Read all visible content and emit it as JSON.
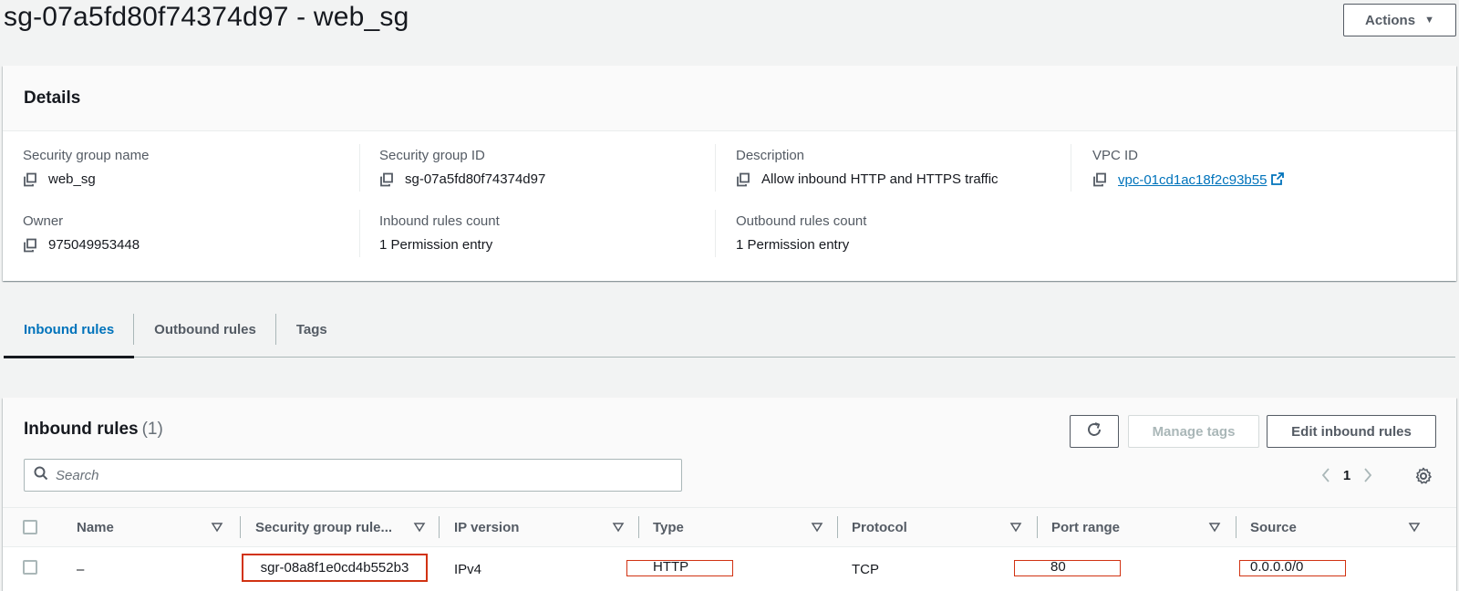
{
  "page": {
    "title": "sg-07a5fd80f74374d97 - web_sg",
    "actions_label": "Actions"
  },
  "details": {
    "heading": "Details",
    "security_group_name_label": "Security group name",
    "security_group_name": "web_sg",
    "security_group_id_label": "Security group ID",
    "security_group_id": "sg-07a5fd80f74374d97",
    "description_label": "Description",
    "description": "Allow inbound HTTP and HTTPS traffic",
    "vpc_id_label": "VPC ID",
    "vpc_id": "vpc-01cd1ac18f2c93b55",
    "owner_label": "Owner",
    "owner": "975049953448",
    "inbound_count_label": "Inbound rules count",
    "inbound_count": "1 Permission entry",
    "outbound_count_label": "Outbound rules count",
    "outbound_count": "1 Permission entry"
  },
  "tabs": [
    {
      "label": "Inbound rules",
      "active": true
    },
    {
      "label": "Outbound rules",
      "active": false
    },
    {
      "label": "Tags",
      "active": false
    }
  ],
  "rules": {
    "title": "Inbound rules",
    "count": "(1)",
    "manage_tags_label": "Manage tags",
    "edit_label": "Edit inbound rules",
    "search_placeholder": "Search",
    "page_number": "1",
    "columns": [
      "Name",
      "Security group rule...",
      "IP version",
      "Type",
      "Protocol",
      "Port range",
      "Source"
    ],
    "rows": [
      {
        "name": "–",
        "rule_id": "sgr-08a8f1e0cd4b552b3",
        "ip_version": "IPv4",
        "type": "HTTP",
        "protocol": "TCP",
        "port_range": "80",
        "source": "0.0.0.0/0"
      }
    ]
  },
  "colors": {
    "accent": "#0073bb",
    "highlight": "#d13212",
    "background": "#f2f3f3"
  },
  "icons": [
    "copy-icon",
    "external-link-icon",
    "refresh-icon",
    "search-icon",
    "chevron-left-icon",
    "chevron-right-icon",
    "settings-gear-icon",
    "sort-caret-icon",
    "caret-down-icon"
  ]
}
